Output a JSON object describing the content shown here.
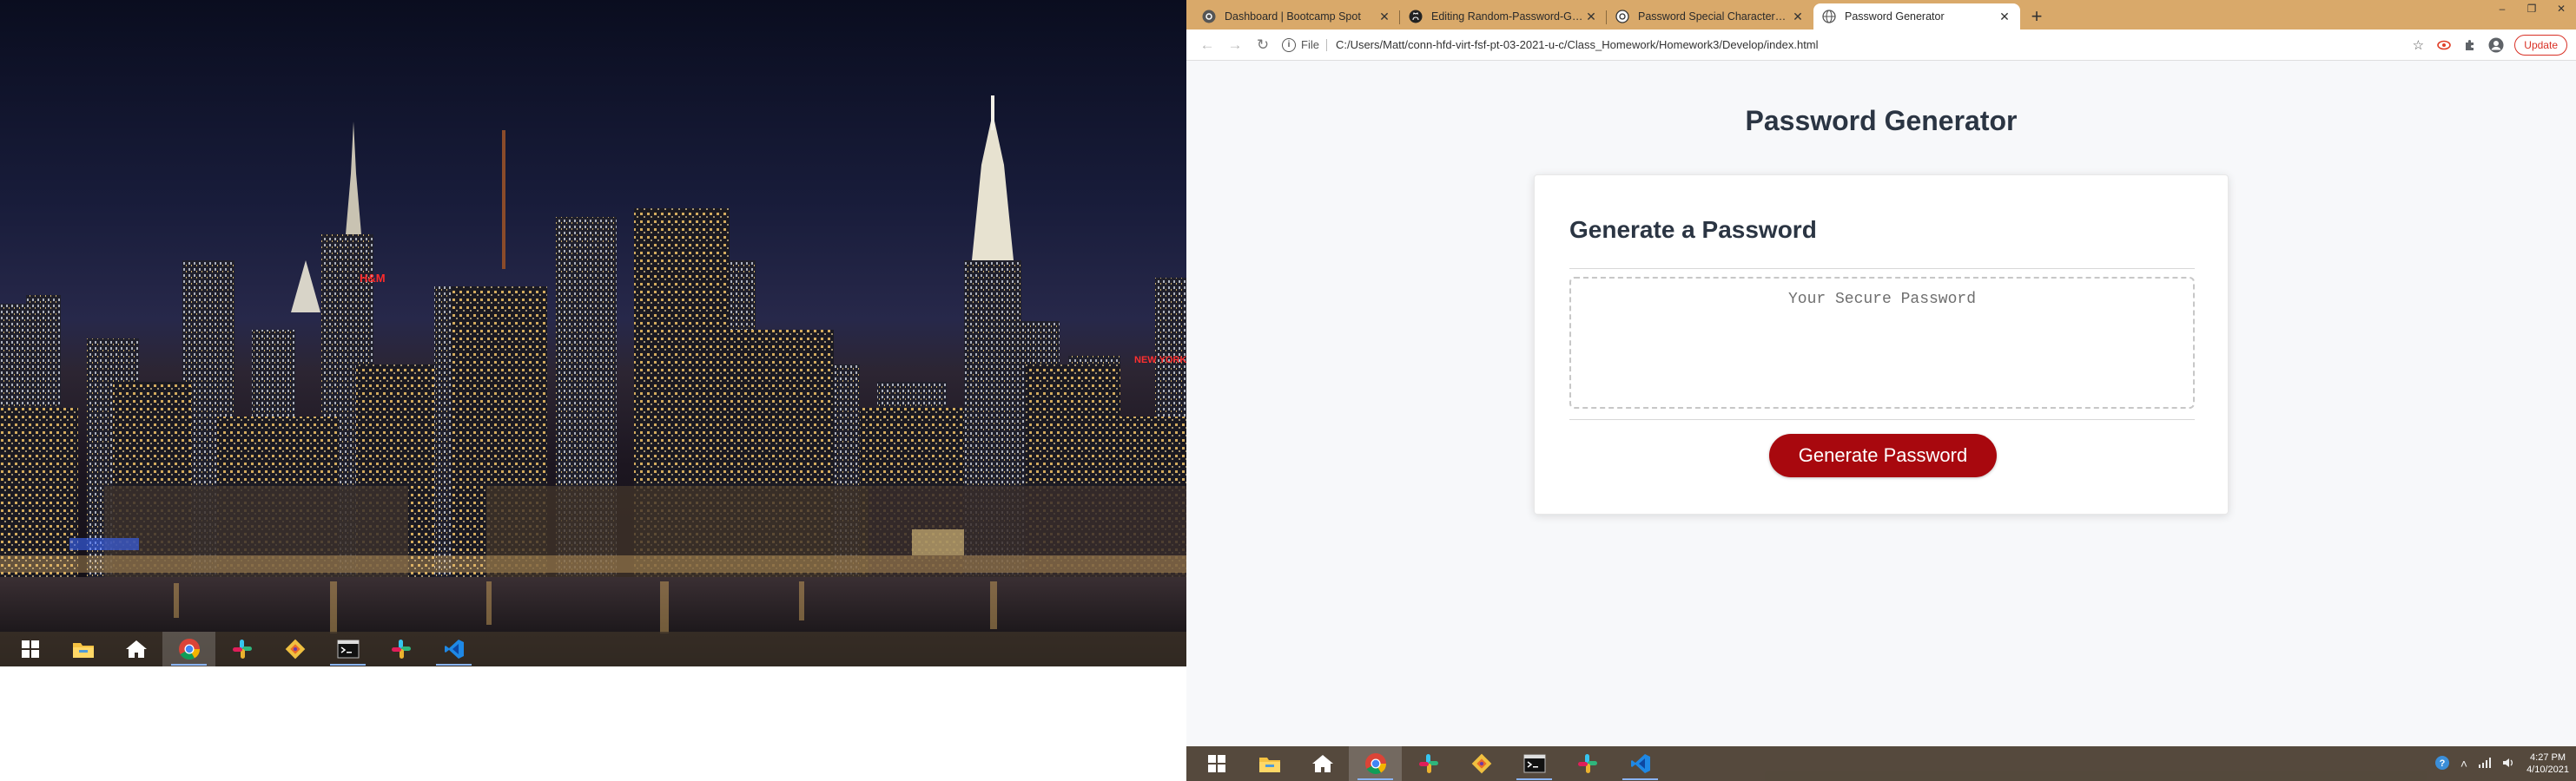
{
  "left_monitor": {
    "taskbar": {
      "items": [
        {
          "icon": "windows-start-icon"
        },
        {
          "icon": "file-explorer-icon"
        },
        {
          "icon": "home-icon"
        },
        {
          "icon": "chrome-icon"
        },
        {
          "icon": "slack-icon"
        },
        {
          "icon": "git-icon"
        },
        {
          "icon": "terminal-icon"
        },
        {
          "icon": "slack-icon"
        },
        {
          "icon": "vscode-icon"
        }
      ]
    },
    "wallpaper": {
      "sign_hm": "H&M",
      "sign_new_yorker": "NEW YORKER"
    }
  },
  "browser": {
    "tabs": [
      {
        "title": "Dashboard | Bootcamp Spot",
        "icon": "bootcamp-icon",
        "active": false
      },
      {
        "title": "Editing Random-Password-Gene",
        "icon": "github-icon",
        "active": false
      },
      {
        "title": "Password Special Characters | OW",
        "icon": "owasp-icon",
        "active": false
      },
      {
        "title": "Password Generator",
        "icon": "globe-icon",
        "active": true
      }
    ],
    "new_tab_label": "+",
    "window_controls": {
      "minimize": "–",
      "maximize": "❐",
      "close": "✕"
    },
    "toolbar": {
      "back": "←",
      "forward": "→",
      "reload": "↻",
      "info": "i",
      "scheme": "File",
      "url": "C:/Users/Matt/conn-hfd-virt-fsf-pt-03-2021-u-c/Class_Homework/Homework3/Develop/index.html",
      "star": "☆",
      "update_label": "Update"
    }
  },
  "page": {
    "heading": "Password Generator",
    "card_header": "Generate a Password",
    "password_placeholder": "Your Secure Password",
    "generate_button": "Generate Password"
  },
  "right_monitor": {
    "taskbar": {
      "items": [
        {
          "icon": "windows-start-icon"
        },
        {
          "icon": "file-explorer-icon"
        },
        {
          "icon": "home-icon"
        },
        {
          "icon": "chrome-icon"
        },
        {
          "icon": "slack-icon"
        },
        {
          "icon": "git-icon"
        },
        {
          "icon": "terminal-icon"
        },
        {
          "icon": "slack-icon"
        },
        {
          "icon": "vscode-icon"
        }
      ]
    },
    "clock": {
      "time": "4:27 PM",
      "date": "4/10/2021"
    }
  },
  "colors": {
    "accent_red": "#a8080e",
    "heading_text": "#2b3543",
    "tabstrip": "#d9a96a"
  }
}
